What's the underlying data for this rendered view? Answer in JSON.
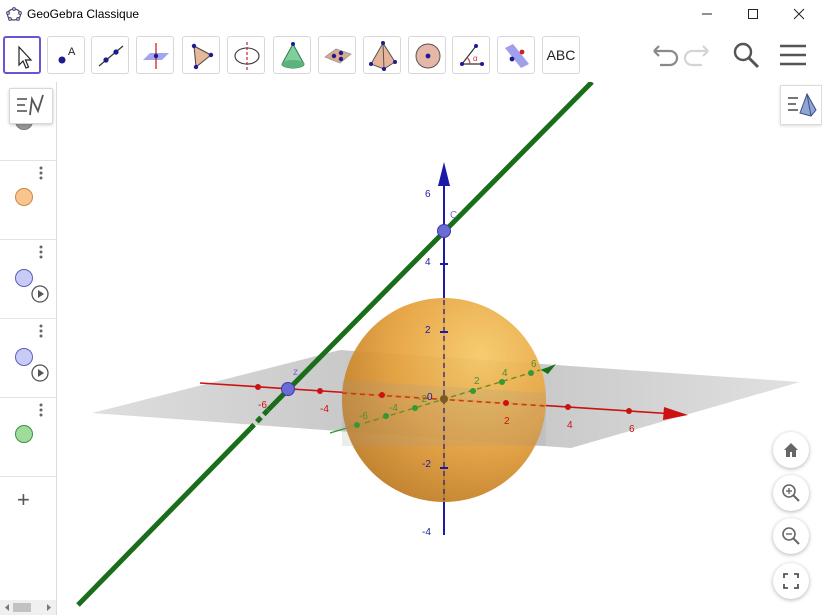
{
  "window": {
    "title": "GeoGebra Classique",
    "controls": [
      "minimize-icon",
      "maximize-icon",
      "close-icon"
    ]
  },
  "toolbar": {
    "tools": [
      {
        "name": "move-tool",
        "icon": "cursor-arrow-icon",
        "selected": true
      },
      {
        "name": "point-tool",
        "icon": "point-icon"
      },
      {
        "name": "line-tool",
        "icon": "line-icon"
      },
      {
        "name": "perpendicular-line-tool",
        "icon": "perpendicular-line-icon"
      },
      {
        "name": "polygon-tool",
        "icon": "polygon-icon"
      },
      {
        "name": "circle-tool",
        "icon": "circle-axis-icon"
      },
      {
        "name": "cone-tool",
        "icon": "cone-icon"
      },
      {
        "name": "plane-tool",
        "icon": "plane-icon"
      },
      {
        "name": "pyramid-tool",
        "icon": "pyramid-icon"
      },
      {
        "name": "sphere-tool",
        "icon": "sphere-icon"
      },
      {
        "name": "angle-tool",
        "icon": "angle-icon"
      },
      {
        "name": "reflect-tool",
        "icon": "reflect-icon"
      },
      {
        "name": "text-tool",
        "label": "ABC"
      }
    ],
    "right": [
      "undo-icon",
      "redo-icon",
      "search-icon",
      "menu-icon"
    ]
  },
  "algebra": {
    "items": [
      {
        "color": "#999999",
        "partial": true
      },
      {
        "color": "#f4b971",
        "has_play": false
      },
      {
        "color": "#c3c6f5",
        "has_play": true
      },
      {
        "color": "#c3c6f5",
        "has_play": true
      },
      {
        "color": "#8fd18f",
        "has_play": false
      }
    ],
    "add_label": "+"
  },
  "graphics3d": {
    "z_ticks": [
      "6",
      "4",
      "2",
      "0",
      "-2",
      "-4"
    ],
    "x_ticks": [
      "-6",
      "-4",
      "2",
      "4",
      "6"
    ],
    "y_ticks": [
      "-6",
      "-4",
      "-2",
      "2",
      "4",
      "6"
    ],
    "point_labels": [
      "C",
      "z"
    ],
    "colors": {
      "x_axis": "#cc1111",
      "y_axis": "#339933",
      "z_axis": "#1a1aa6",
      "sphere": "#e6a13c",
      "line": "#1a6e1a",
      "plane": "#9a9a9a"
    }
  },
  "nav_buttons": [
    "home-icon",
    "zoom-in-icon",
    "zoom-out-icon",
    "fullscreen-icon"
  ]
}
